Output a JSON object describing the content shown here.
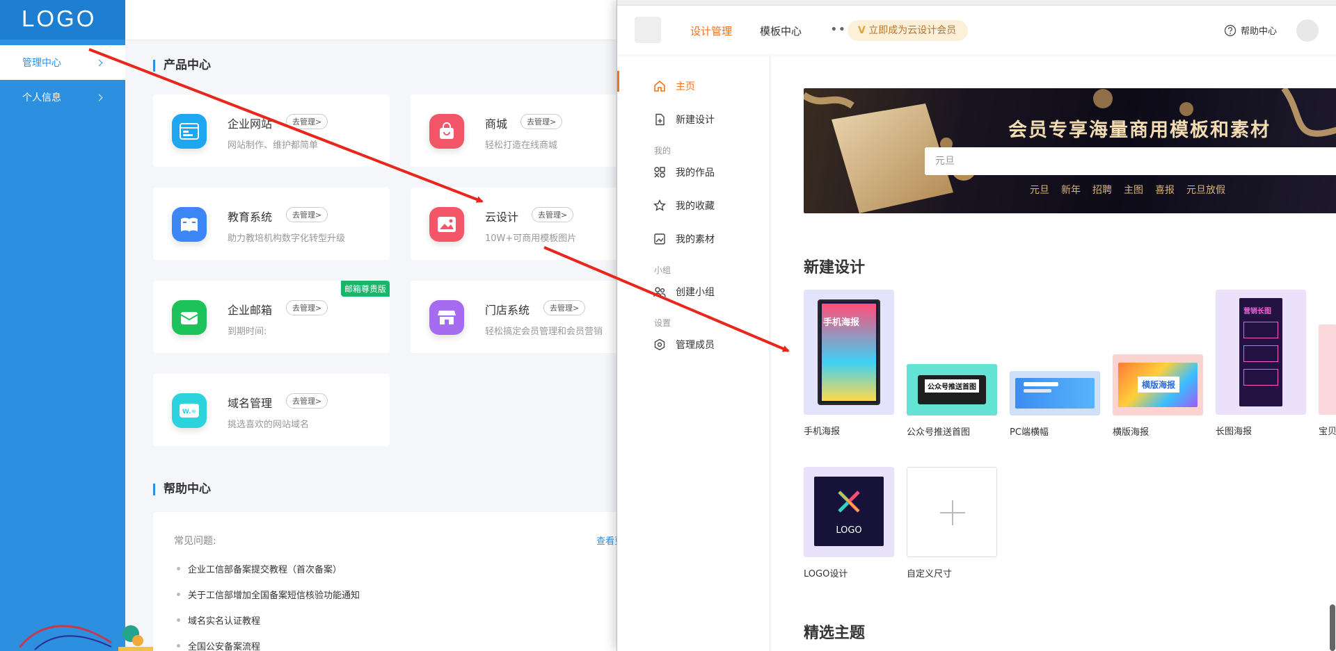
{
  "sidebar": {
    "logo": "LOGO",
    "items": [
      {
        "label": "管理中心",
        "active": true
      },
      {
        "label": "个人信息",
        "active": false
      }
    ]
  },
  "main": {
    "product_title": "产品中心",
    "products": [
      {
        "name": "企业网站",
        "manage": "去管理>",
        "desc": "网站制作、维护都简单",
        "color": "#1ea7f0",
        "icon": "browser-icon"
      },
      {
        "name": "商城",
        "manage": "去管理>",
        "desc": "轻松打造在线商城",
        "color": "#f25468",
        "icon": "shopping-bag-icon"
      },
      {
        "name": "教育系统",
        "manage": "去管理>",
        "desc": "助力教培机构数字化转型升级",
        "color": "#3d86f5",
        "icon": "book-icon"
      },
      {
        "name": "云设计",
        "manage": "去管理>",
        "desc": "10W+可商用模板图片",
        "color": "#f35669",
        "icon": "image-icon"
      },
      {
        "name": "企业邮箱",
        "manage": "去管理>",
        "desc": "到期时间:",
        "color": "#1ec25a",
        "icon": "mail-icon",
        "badge": "邮箱尊贵版"
      },
      {
        "name": "门店系统",
        "manage": "去管理>",
        "desc": "轻松搞定会员管理和会员营销",
        "color": "#a56cf2",
        "icon": "store-icon"
      },
      {
        "name": "域名管理",
        "manage": "去管理>",
        "desc": "挑选喜欢的网站域名",
        "color": "#2cd3dc",
        "icon": "domain-icon"
      }
    ],
    "help_title": "帮助中心",
    "help": {
      "faq_label": "常见问题:",
      "more": "查看更多>",
      "items": [
        "企业工信部备案提交教程（首次备案）",
        "关于工信部增加全国备案短信核验功能通知",
        "域名实名认证教程",
        "全国公安备案流程"
      ]
    }
  },
  "design": {
    "nav": {
      "design_manage": "设计管理",
      "template_center": "模板中心",
      "vip_button": "立即成为云设计会员",
      "help": "帮助中心"
    },
    "side": {
      "home": "主页",
      "new_design": "新建设计",
      "group_mine": "我的",
      "my_works": "我的作品",
      "my_favorites": "我的收藏",
      "my_materials": "我的素材",
      "group_team": "小组",
      "create_team": "创建小组",
      "group_settings": "设置",
      "manage_members": "管理成员"
    },
    "banner": {
      "slogan": "会员专享海量商用模板和素材",
      "search_placeholder": "元旦",
      "tags": [
        "元旦",
        "新年",
        "招聘",
        "主图",
        "喜报",
        "元旦放假"
      ]
    },
    "new_design_title": "新建设计",
    "templates": [
      {
        "label": "手机海报",
        "thumb_text": "手机海报"
      },
      {
        "label": "公众号推送首图",
        "thumb_text": "公众号推送首图"
      },
      {
        "label": "PC端横幅",
        "thumb_text": ""
      },
      {
        "label": "横版海报",
        "thumb_text": "横版海报"
      },
      {
        "label": "长图海报",
        "thumb_text": "营销长图"
      },
      {
        "label": "宝贝"
      },
      {
        "label": "LOGO设计",
        "thumb_text": "LOGO"
      },
      {
        "label": "自定义尺寸"
      }
    ],
    "featured_title": "精选主题"
  },
  "colors": {
    "sidebar_blue": "#2d8fe0",
    "design_orange": "#f2711c",
    "arrow_red": "#e8261c"
  }
}
